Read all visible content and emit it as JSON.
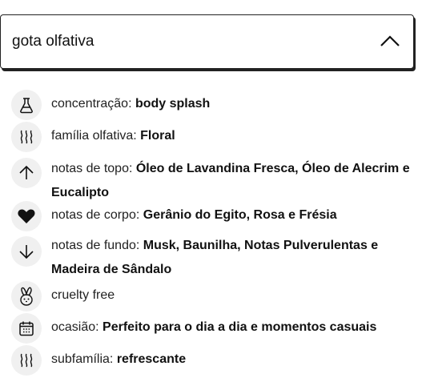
{
  "accordion": {
    "title": "gota olfativa",
    "expanded": true,
    "chevron_icon": "chevron-up-icon"
  },
  "details": [
    {
      "icon": "flask-icon",
      "label": "concentração",
      "separator": ": ",
      "value": "body splash"
    },
    {
      "icon": "scent-waves-icon",
      "label": "família olfativa",
      "separator": ": ",
      "value": "Floral"
    },
    {
      "icon": "arrow-up-icon",
      "label": "notas de topo",
      "separator": ": ",
      "value": "Óleo de Lavandina Fresca, Óleo de Alecrim e Eucalipto"
    },
    {
      "icon": "heart-icon",
      "label": "notas de corpo",
      "separator": ": ",
      "value": "Gerânio do Egito, Rosa e Frésia"
    },
    {
      "icon": "arrow-down-icon",
      "label": "notas de fundo",
      "separator": ": ",
      "value": "Musk, Baunilha, Notas Pulverulentas e Madeira de Sândalo"
    },
    {
      "icon": "bunny-icon",
      "label": "cruelty free",
      "separator": "",
      "value": ""
    },
    {
      "icon": "calendar-icon",
      "label": "ocasião",
      "separator": ": ",
      "value": "Perfeito para o dia a dia e momentos casuais"
    },
    {
      "icon": "scent-waves-icon",
      "label": "subfamília",
      "separator": ": ",
      "value": "refrescante"
    }
  ]
}
